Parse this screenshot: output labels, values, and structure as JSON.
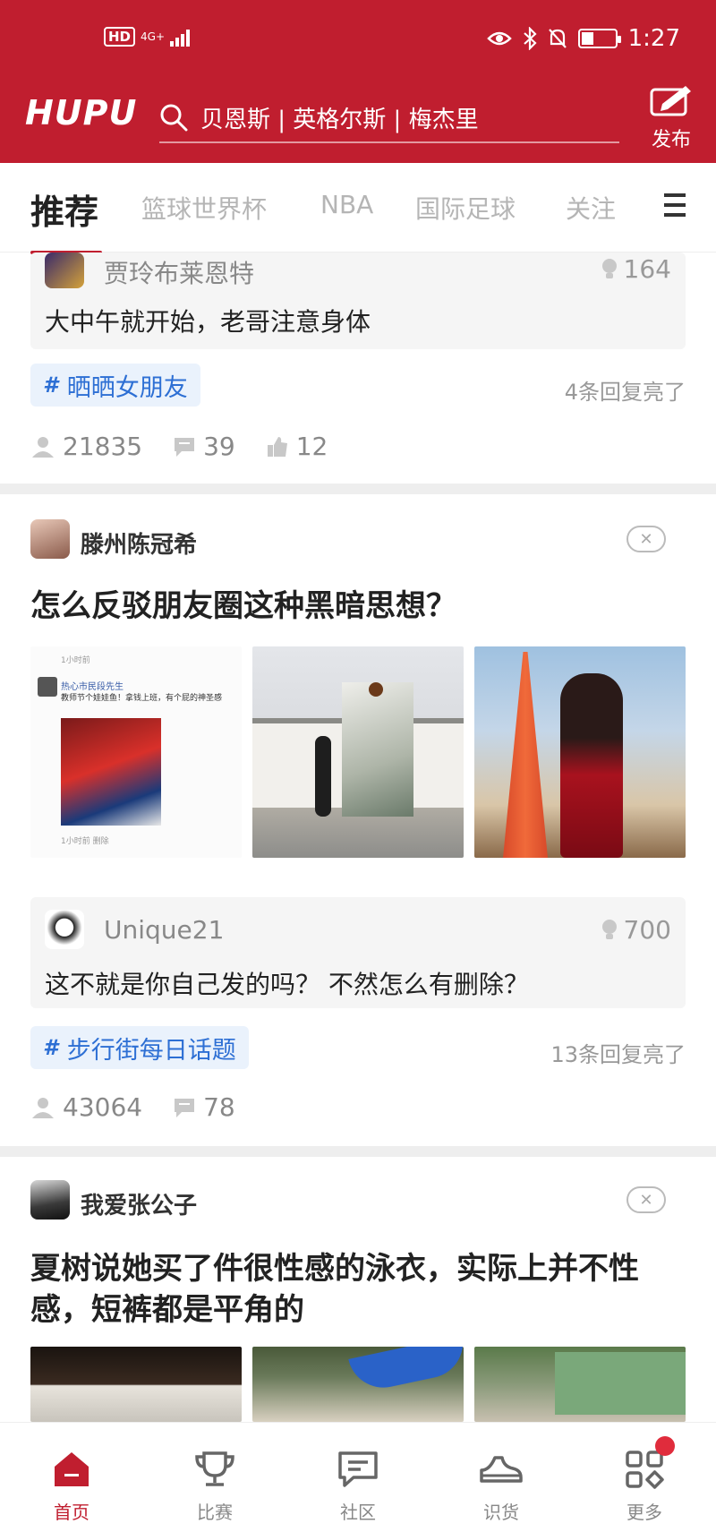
{
  "status_bar": {
    "network": "4G+",
    "signal": "HD",
    "time": "1:27",
    "battery_level": 0.35
  },
  "header": {
    "logo": "HUPU",
    "search_text": "贝恩斯 | 英格尔斯 | 梅杰里",
    "publish_label": "发布"
  },
  "tabs": [
    {
      "label": "推荐"
    },
    {
      "label": "篮球世界杯"
    },
    {
      "label": "NBA"
    },
    {
      "label": "国际足球"
    },
    {
      "label": "关注"
    }
  ],
  "posts": [
    {
      "comment": {
        "author": "贾玲布莱恩特",
        "lights": "164",
        "text": "大中午就开始，老哥注意身体"
      },
      "topic": "晒晒女朋友",
      "reply_count": "4条回复亮了",
      "stats": {
        "views": "21835",
        "comments": "39",
        "likes": "12"
      }
    },
    {
      "author": "滕州陈冠希",
      "title": "怎么反驳朋友圈这种黑暗思想？",
      "thumb_text": {
        "time": "1小时前",
        "name": "热心市民段先生",
        "body": "教师节个娃娃鱼！拿钱上班，有个屁的神圣感",
        "time2": "1小时前 删除"
      },
      "comment": {
        "author": "Unique21",
        "lights": "700",
        "text": "这不就是你自己发的吗？ 不然怎么有删除？"
      },
      "topic": "步行街每日话题",
      "reply_count": "13条回复亮了",
      "stats": {
        "views": "43064",
        "comments": "78"
      }
    },
    {
      "author": "我爱张公子",
      "title": "夏树说她买了件很性感的泳衣，实际上并不性感，短裤都是平角的"
    }
  ],
  "bottom_nav": [
    {
      "label": "首页"
    },
    {
      "label": "比赛"
    },
    {
      "label": "社区"
    },
    {
      "label": "识货"
    },
    {
      "label": "更多"
    }
  ],
  "colors": {
    "brand": "#c01e2f",
    "topic": "#2d6fd4"
  }
}
